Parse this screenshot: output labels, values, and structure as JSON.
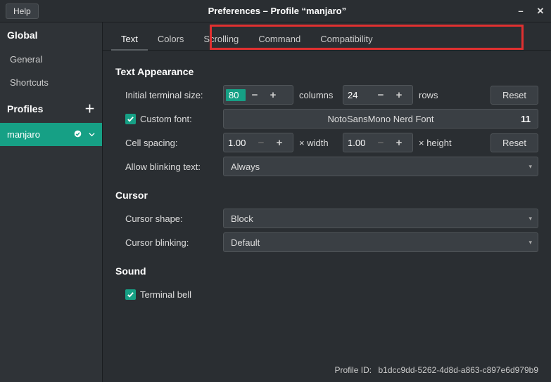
{
  "window": {
    "help": "Help",
    "title": "Preferences – Profile “manjaro”"
  },
  "sidebar": {
    "global": "Global",
    "general": "General",
    "shortcuts": "Shortcuts",
    "profiles": "Profiles",
    "profile_name": "manjaro"
  },
  "tabs": {
    "text": "Text",
    "colors": "Colors",
    "scrolling": "Scrolling",
    "command": "Command",
    "compatibility": "Compatibility"
  },
  "text_appearance": {
    "heading": "Text Appearance",
    "initial_size_label": "Initial terminal size:",
    "cols_value": "80",
    "cols_unit": "columns",
    "rows_value": "24",
    "rows_unit": "rows",
    "reset": "Reset",
    "custom_font_label": "Custom font:",
    "font_name": "NotoSansMono Nerd Font",
    "font_size": "11",
    "cell_spacing_label": "Cell spacing:",
    "width_value": "1.00",
    "width_unit": "× width",
    "height_value": "1.00",
    "height_unit": "× height",
    "reset2": "Reset",
    "allow_blinking_label": "Allow blinking text:",
    "allow_blinking_value": "Always"
  },
  "cursor": {
    "heading": "Cursor",
    "shape_label": "Cursor shape:",
    "shape_value": "Block",
    "blinking_label": "Cursor blinking:",
    "blinking_value": "Default"
  },
  "sound": {
    "heading": "Sound",
    "terminal_bell": "Terminal bell"
  },
  "footer": {
    "label": "Profile ID:",
    "value": "b1dcc9dd-5262-4d8d-a863-c897e6d979b9"
  }
}
